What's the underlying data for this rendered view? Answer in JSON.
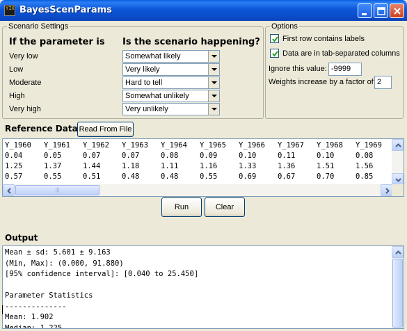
{
  "window": {
    "title": "BayesScenParams",
    "icon_name": "app-icon",
    "icon_text": "YIX"
  },
  "scenario": {
    "group_title": "Scenario Settings",
    "col_param": "If the parameter is",
    "col_happening": "Is the scenario happening?",
    "rows": [
      {
        "label": "Very low",
        "value": "Somewhat likely"
      },
      {
        "label": "Low",
        "value": "Very likely"
      },
      {
        "label": "Moderate",
        "value": "Hard to tell"
      },
      {
        "label": "High",
        "value": "Somewhat unlikely"
      },
      {
        "label": "Very high",
        "value": "Very unlikely"
      }
    ]
  },
  "options": {
    "group_title": "Options",
    "first_row_labels": {
      "label": "First row contains labels",
      "checked": true
    },
    "tab_separated": {
      "label": "Data are in tab-separated columns",
      "checked": true
    },
    "ignore_label": "Ignore this value:",
    "ignore_value": "-9999",
    "weights_label": "Weights increase by a factor of",
    "weights_value": "2"
  },
  "reference": {
    "title": "Reference Data",
    "read_button": "Read From File",
    "rows": [
      [
        "Y_1960",
        "Y_1961",
        "Y_1962",
        "Y_1963",
        "Y_1964",
        "Y_1965",
        "Y_1966",
        "Y_1967",
        "Y_1968",
        "Y_1969"
      ],
      [
        "0.04",
        "0.05",
        "0.07",
        "0.07",
        "0.08",
        "0.09",
        "0.10",
        "0.11",
        "0.10",
        "0.08"
      ],
      [
        "1.25",
        "1.37",
        "1.44",
        "1.18",
        "1.11",
        "1.16",
        "1.33",
        "1.36",
        "1.51",
        "1.56"
      ],
      [
        "0.57",
        "0.55",
        "0.51",
        "0.48",
        "0.48",
        "0.55",
        "0.69",
        "0.67",
        "0.70",
        "0.85"
      ]
    ]
  },
  "actions": {
    "run": "Run",
    "clear": "Clear"
  },
  "output": {
    "title": "Output",
    "lines": [
      "Mean ± sd: 5.601 ± 9.163",
      "(Min, Max): (0.000, 91.880)",
      "[95% confidence interval]: [0.040 to 25.450]",
      "",
      "Parameter Statistics",
      "--------------",
      "Mean: 1.902",
      "Median: 1.225"
    ]
  },
  "colors": {
    "title_bar": "#0a4cc9",
    "window_bg": "#ece9d8",
    "close_button": "#c9401d"
  }
}
